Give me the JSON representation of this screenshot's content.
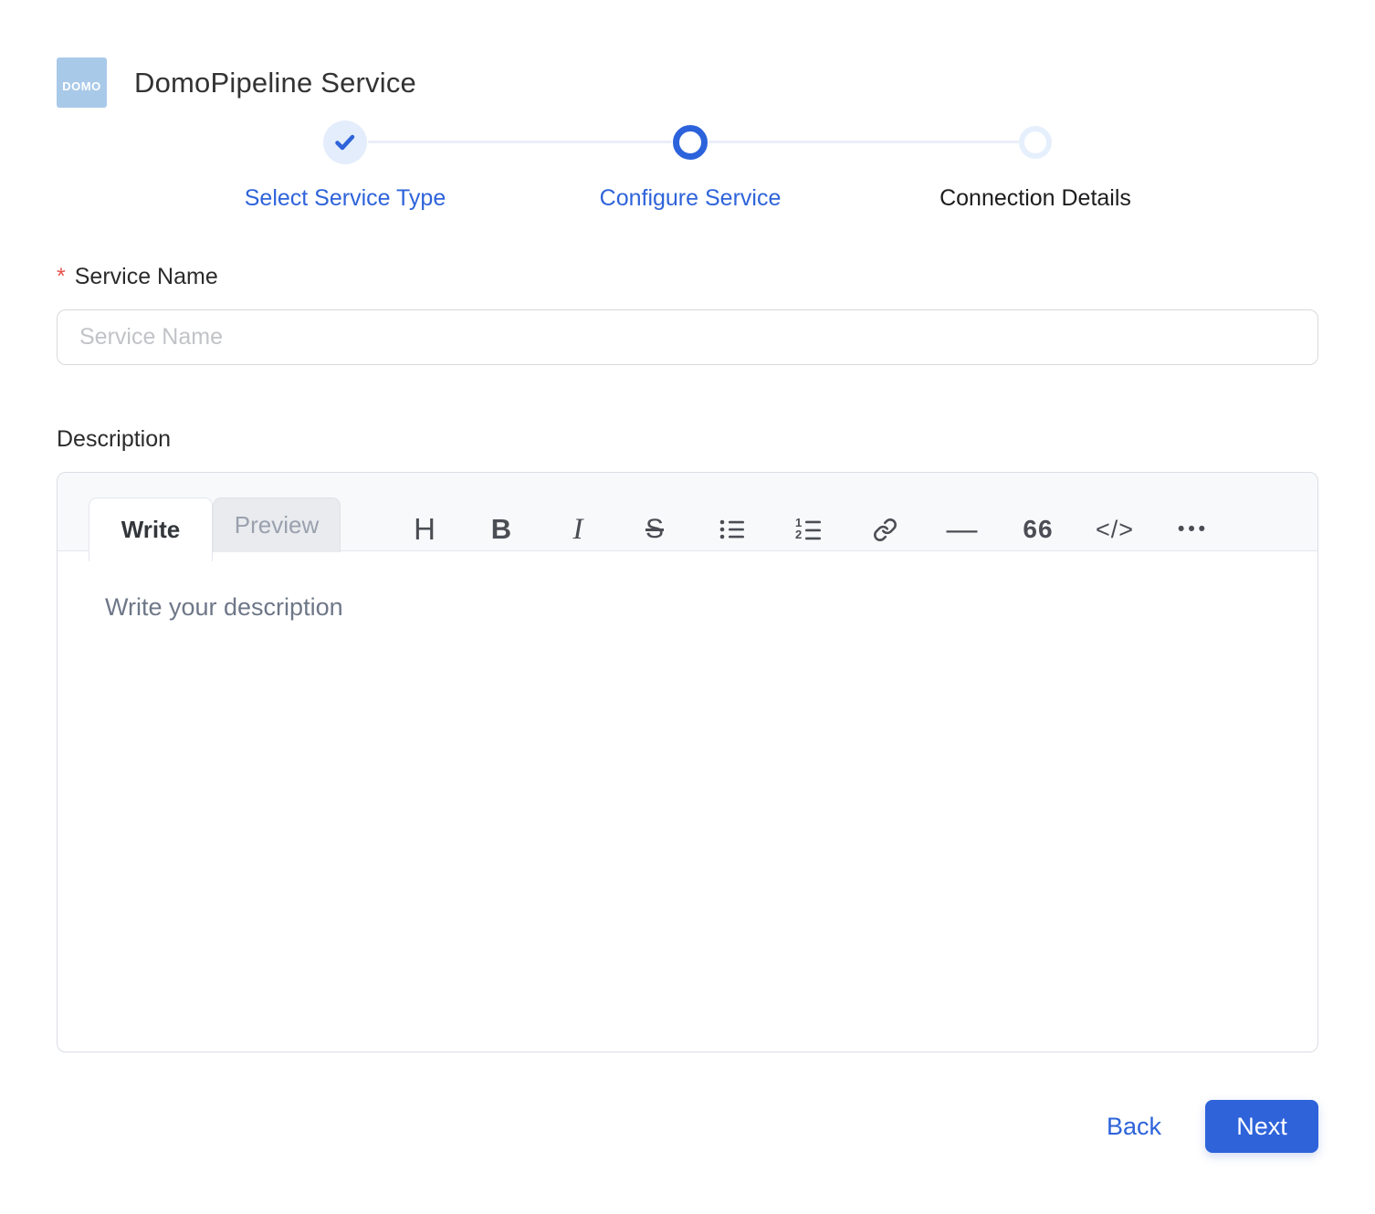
{
  "header": {
    "logo_text": "DOMO",
    "title": "DomoPipeline Service"
  },
  "stepper": {
    "steps": [
      {
        "label": "Select Service Type",
        "state": "completed"
      },
      {
        "label": "Configure Service",
        "state": "active"
      },
      {
        "label": "Connection Details",
        "state": "upcoming"
      }
    ]
  },
  "form": {
    "service_name": {
      "required_marker": "*",
      "label": "Service Name",
      "placeholder": "Service Name",
      "value": ""
    },
    "description": {
      "label": "Description"
    }
  },
  "editor": {
    "tabs": [
      {
        "label": "Write",
        "active": true
      },
      {
        "label": "Preview",
        "active": false
      }
    ],
    "toolbar": [
      {
        "name": "header",
        "glyph": "H"
      },
      {
        "name": "bold",
        "glyph": "B"
      },
      {
        "name": "italic",
        "glyph": "I"
      },
      {
        "name": "strikethrough",
        "glyph": "S"
      },
      {
        "name": "unordered-list",
        "glyph": ""
      },
      {
        "name": "ordered-list",
        "glyph": ""
      },
      {
        "name": "link",
        "glyph": ""
      },
      {
        "name": "horizontal-rule",
        "glyph": "—"
      },
      {
        "name": "quote",
        "glyph": "66"
      },
      {
        "name": "code",
        "glyph": "</>"
      },
      {
        "name": "more",
        "glyph": "•••"
      }
    ],
    "placeholder": "Write your description",
    "value": ""
  },
  "footer": {
    "back_label": "Back",
    "next_label": "Next"
  },
  "colors": {
    "accent": "#2e63da",
    "logo_background": "#a9c9e9",
    "required_marker": "#e8544d",
    "completed_halo": "#e4edfb",
    "upcoming_ring": "#e6effc",
    "connector": "#e9eef8"
  }
}
